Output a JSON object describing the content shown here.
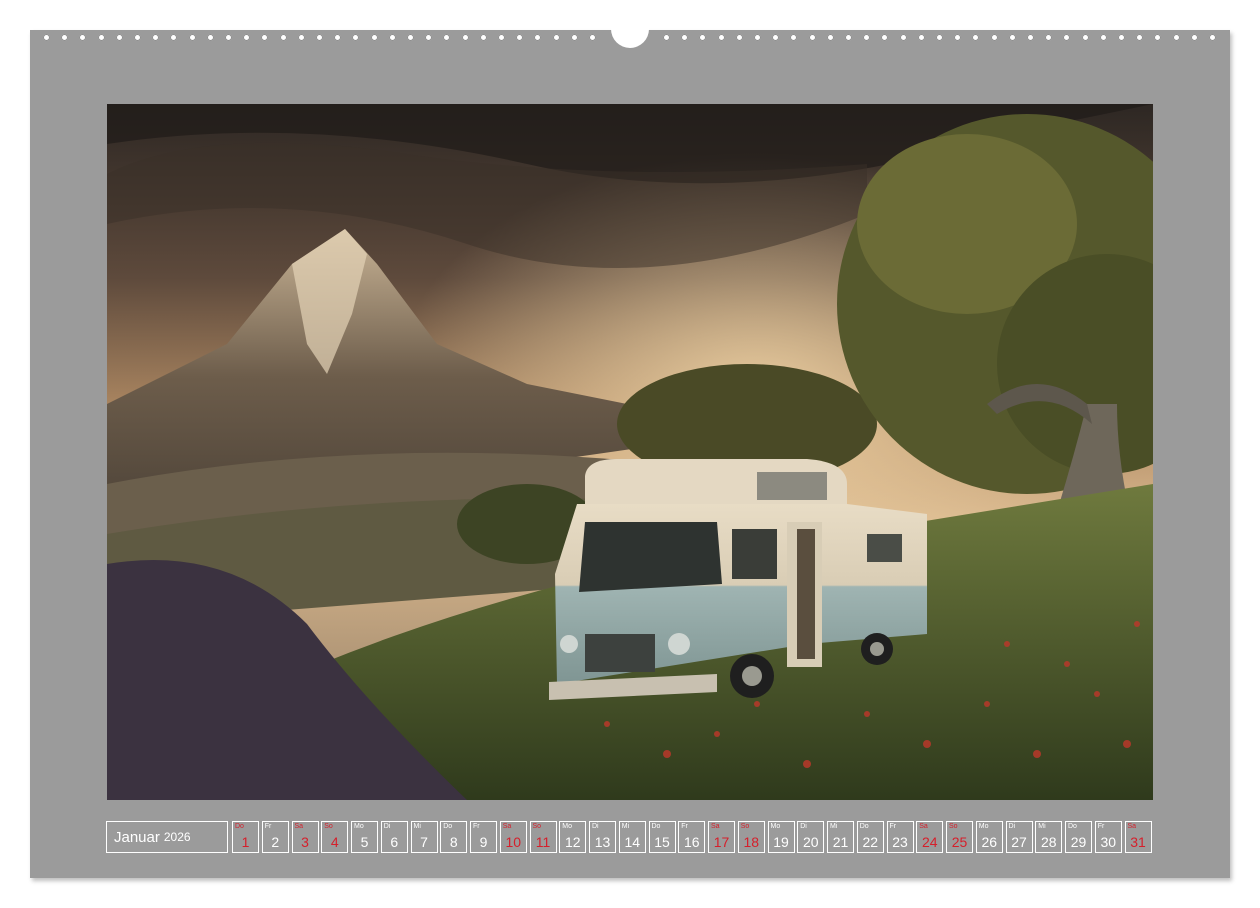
{
  "calendar": {
    "month": "Januar",
    "year": "2026",
    "accent_color": "#d51f2b",
    "days": [
      {
        "wd": "Do",
        "num": "1",
        "type": "holiday"
      },
      {
        "wd": "Fr",
        "num": "2",
        "type": "normal"
      },
      {
        "wd": "Sa",
        "num": "3",
        "type": "weekend"
      },
      {
        "wd": "So",
        "num": "4",
        "type": "weekend"
      },
      {
        "wd": "Mo",
        "num": "5",
        "type": "normal"
      },
      {
        "wd": "Di",
        "num": "6",
        "type": "normal"
      },
      {
        "wd": "Mi",
        "num": "7",
        "type": "normal"
      },
      {
        "wd": "Do",
        "num": "8",
        "type": "normal"
      },
      {
        "wd": "Fr",
        "num": "9",
        "type": "normal"
      },
      {
        "wd": "Sa",
        "num": "10",
        "type": "weekend"
      },
      {
        "wd": "So",
        "num": "11",
        "type": "weekend"
      },
      {
        "wd": "Mo",
        "num": "12",
        "type": "normal"
      },
      {
        "wd": "Di",
        "num": "13",
        "type": "normal"
      },
      {
        "wd": "Mi",
        "num": "14",
        "type": "normal"
      },
      {
        "wd": "Do",
        "num": "15",
        "type": "normal"
      },
      {
        "wd": "Fr",
        "num": "16",
        "type": "normal"
      },
      {
        "wd": "Sa",
        "num": "17",
        "type": "weekend"
      },
      {
        "wd": "So",
        "num": "18",
        "type": "weekend"
      },
      {
        "wd": "Mo",
        "num": "19",
        "type": "normal"
      },
      {
        "wd": "Di",
        "num": "20",
        "type": "normal"
      },
      {
        "wd": "Mi",
        "num": "21",
        "type": "normal"
      },
      {
        "wd": "Do",
        "num": "22",
        "type": "normal"
      },
      {
        "wd": "Fr",
        "num": "23",
        "type": "normal"
      },
      {
        "wd": "Sa",
        "num": "24",
        "type": "weekend"
      },
      {
        "wd": "So",
        "num": "25",
        "type": "weekend"
      },
      {
        "wd": "Mo",
        "num": "26",
        "type": "normal"
      },
      {
        "wd": "Di",
        "num": "27",
        "type": "normal"
      },
      {
        "wd": "Mi",
        "num": "28",
        "type": "normal"
      },
      {
        "wd": "Do",
        "num": "29",
        "type": "normal"
      },
      {
        "wd": "Fr",
        "num": "30",
        "type": "normal"
      },
      {
        "wd": "Sa",
        "num": "31",
        "type": "weekend"
      }
    ]
  },
  "colors": {
    "page_background": "#9b9b9b",
    "calendar_text": "#ffffff"
  }
}
